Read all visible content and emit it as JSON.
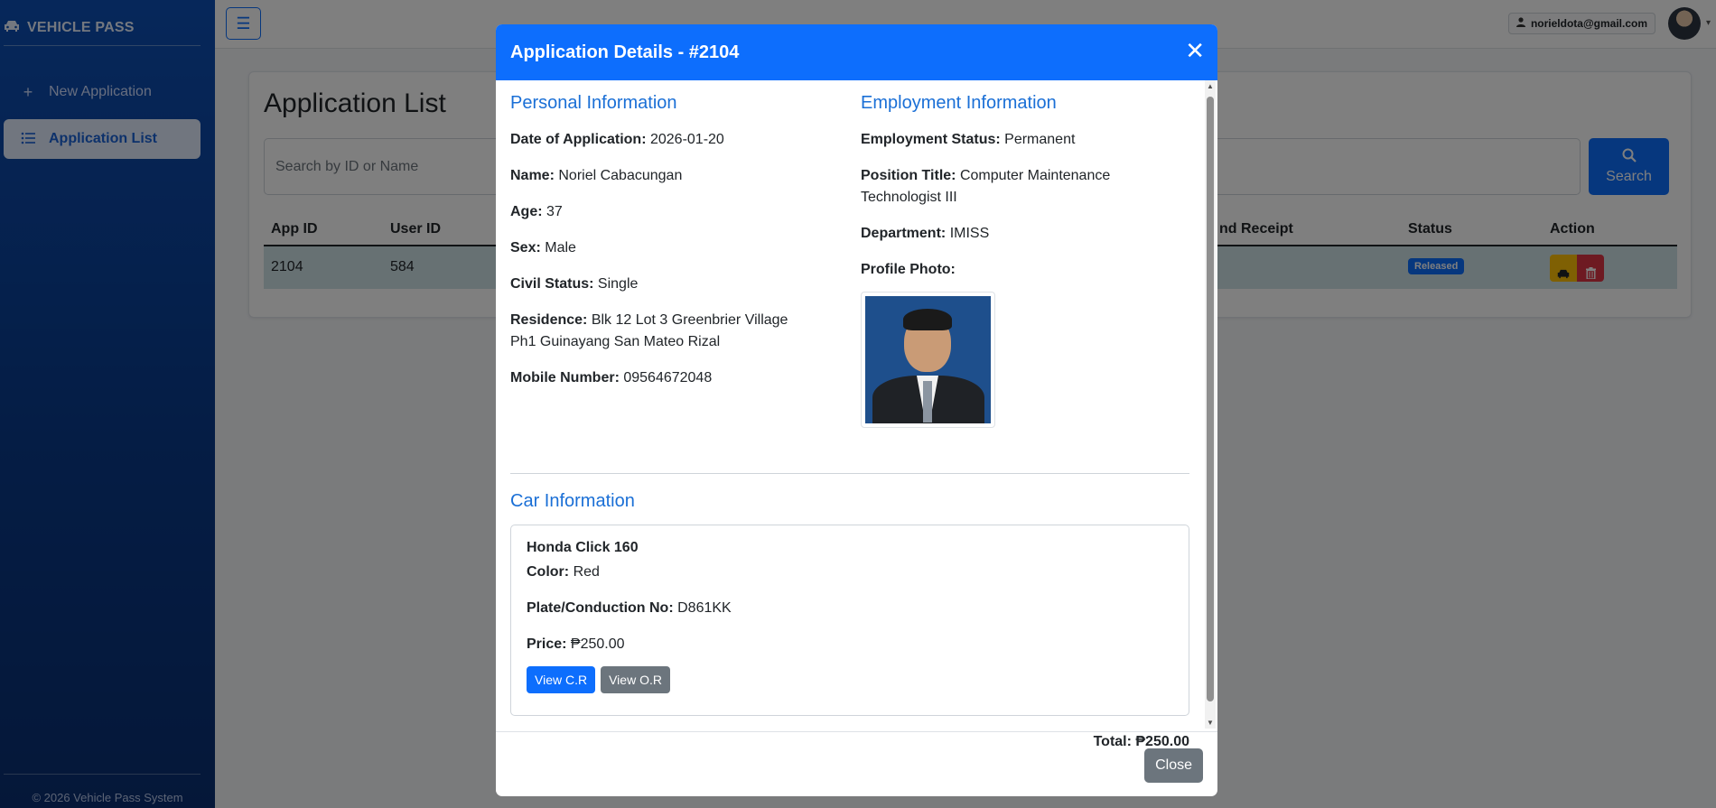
{
  "sidebar": {
    "brand": "VEHICLE PASS",
    "items": [
      {
        "label": "New Application",
        "icon": "plus-icon"
      },
      {
        "label": "Application List",
        "icon": "list-icon"
      }
    ],
    "footer": "© 2026 Vehicle Pass System"
  },
  "topbar": {
    "user_email": "norieldota@gmail.com"
  },
  "main": {
    "title": "Application List",
    "search_placeholder": "Search by ID or Name",
    "search_label": "Search",
    "columns": [
      "App ID",
      "User ID",
      "nd Receipt",
      "Status",
      "Action"
    ],
    "rows": [
      {
        "app_id": "2104",
        "user_id": "584",
        "status": "Released"
      }
    ]
  },
  "modal": {
    "title": "Application Details - #2104",
    "personal": {
      "heading": "Personal Information",
      "fields": [
        {
          "label": "Date of Application:",
          "value": "2026-01-20"
        },
        {
          "label": "Name:",
          "value": "Noriel Cabacungan"
        },
        {
          "label": "Age:",
          "value": "37"
        },
        {
          "label": "Sex:",
          "value": "Male"
        },
        {
          "label": "Civil Status:",
          "value": "Single"
        },
        {
          "label": "Residence:",
          "value": "Blk 12 Lot 3 Greenbrier Village Ph1 Guinayang San Mateo Rizal"
        },
        {
          "label": "Mobile Number:",
          "value": "09564672048"
        }
      ]
    },
    "employment": {
      "heading": "Employment Information",
      "fields": [
        {
          "label": "Employment Status:",
          "value": "Permanent"
        },
        {
          "label": "Position Title:",
          "value": "Computer Maintenance Technologist III"
        },
        {
          "label": "Department:",
          "value": "IMISS"
        }
      ],
      "photo_label": "Profile Photo:"
    },
    "car": {
      "heading": "Car Information",
      "model": "Honda Click 160",
      "color_label": "Color:",
      "color": "Red",
      "plate_label": "Plate/Conduction No:",
      "plate": "D861KK",
      "price_label": "Price:",
      "price": "₱250.00",
      "view_cr": "View C.R",
      "view_or": "View O.R"
    },
    "total": "Total: ₱250.00",
    "close_label": "Close"
  }
}
